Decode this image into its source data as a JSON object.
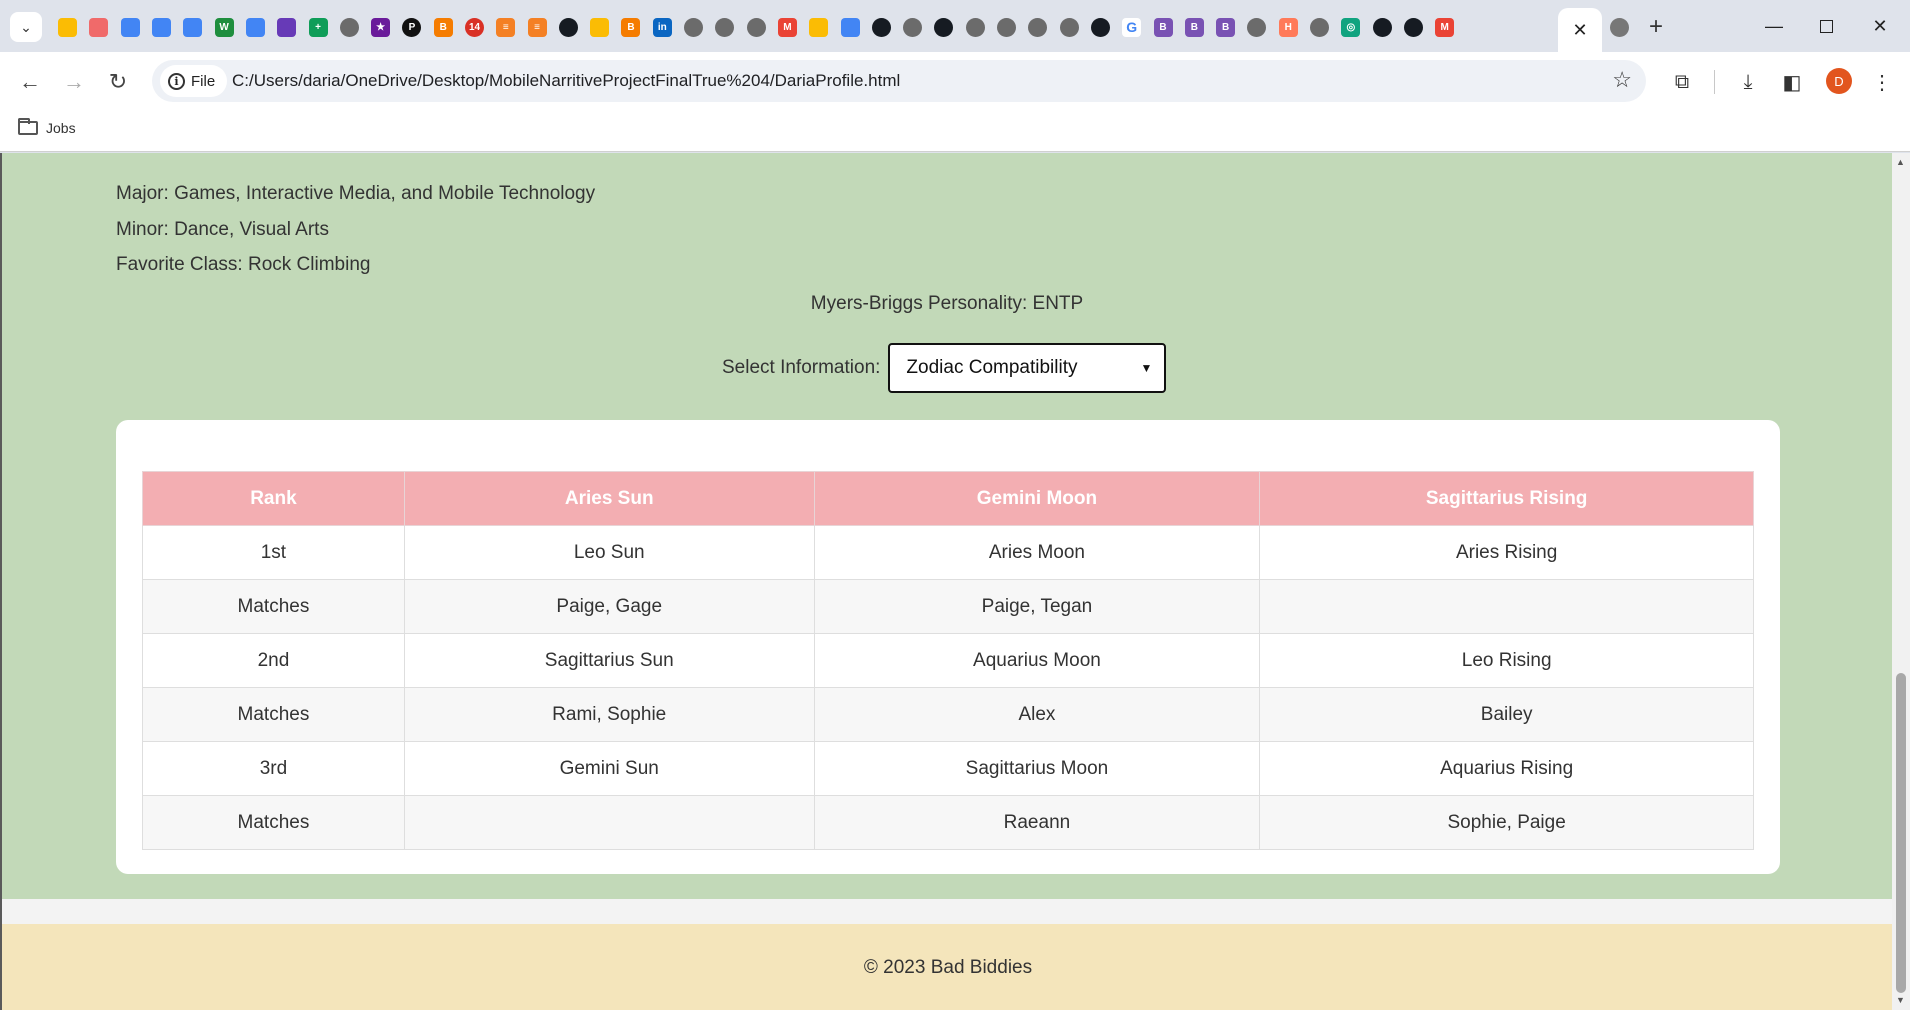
{
  "browser": {
    "tab_favicons": [
      "drive",
      "asana",
      "docs",
      "docs",
      "docs",
      "word-w",
      "docs",
      "forms",
      "sheets",
      "globe",
      "star",
      "p",
      "blogger",
      "badge-14",
      "stack",
      "stack",
      "github",
      "drive",
      "blogger",
      "linkedin",
      "globe",
      "globe",
      "globe",
      "gmail",
      "drive",
      "docs",
      "github",
      "globe",
      "github",
      "globe",
      "globe",
      "globe",
      "globe",
      "github",
      "google",
      "bootstrap",
      "bootstrap",
      "bootstrap",
      "globe",
      "hubspot",
      "globe",
      "chatgpt",
      "github",
      "github",
      "gmail"
    ],
    "active_tab_close": "✕",
    "after_tab_icon": "globe",
    "new_tab": "+",
    "scheme_chip": "File",
    "url": "C:/Users/daria/OneDrive/Desktop/MobileNarritiveProjectFinalTrue%204/DariaProfile.html",
    "avatar_letter": "D",
    "bookmark_folder": "Jobs"
  },
  "profile": {
    "major": "Major: Games, Interactive Media, and Mobile Technology",
    "minor": "Minor: Dance, Visual Arts",
    "favorite_class": "Favorite Class: Rock Climbing",
    "mbti": "Myers-Briggs Personality: ENTP",
    "select_label": "Select Information:",
    "select_value": "Zodiac Compatibility"
  },
  "table": {
    "headers": [
      "Rank",
      "Aries Sun",
      "Gemini Moon",
      "Sagittarius Rising"
    ],
    "rows": [
      [
        "1st",
        "Leo Sun",
        "Aries Moon",
        "Aries Rising"
      ],
      [
        "Matches",
        "Paige, Gage",
        "Paige, Tegan",
        ""
      ],
      [
        "2nd",
        "Sagittarius Sun",
        "Aquarius Moon",
        "Leo Rising"
      ],
      [
        "Matches",
        "Rami, Sophie",
        "Alex",
        "Bailey"
      ],
      [
        "3rd",
        "Gemini Sun",
        "Sagittarius Moon",
        "Aquarius Rising"
      ],
      [
        "Matches",
        "",
        "Raeann",
        "Sophie, Paige"
      ]
    ]
  },
  "footer": {
    "text": "© 2023 Bad Biddies"
  },
  "colors": {
    "page_green": "#c2d9b8",
    "header_pink": "#f3aeb2",
    "footer_cream": "#f4e5bb"
  }
}
